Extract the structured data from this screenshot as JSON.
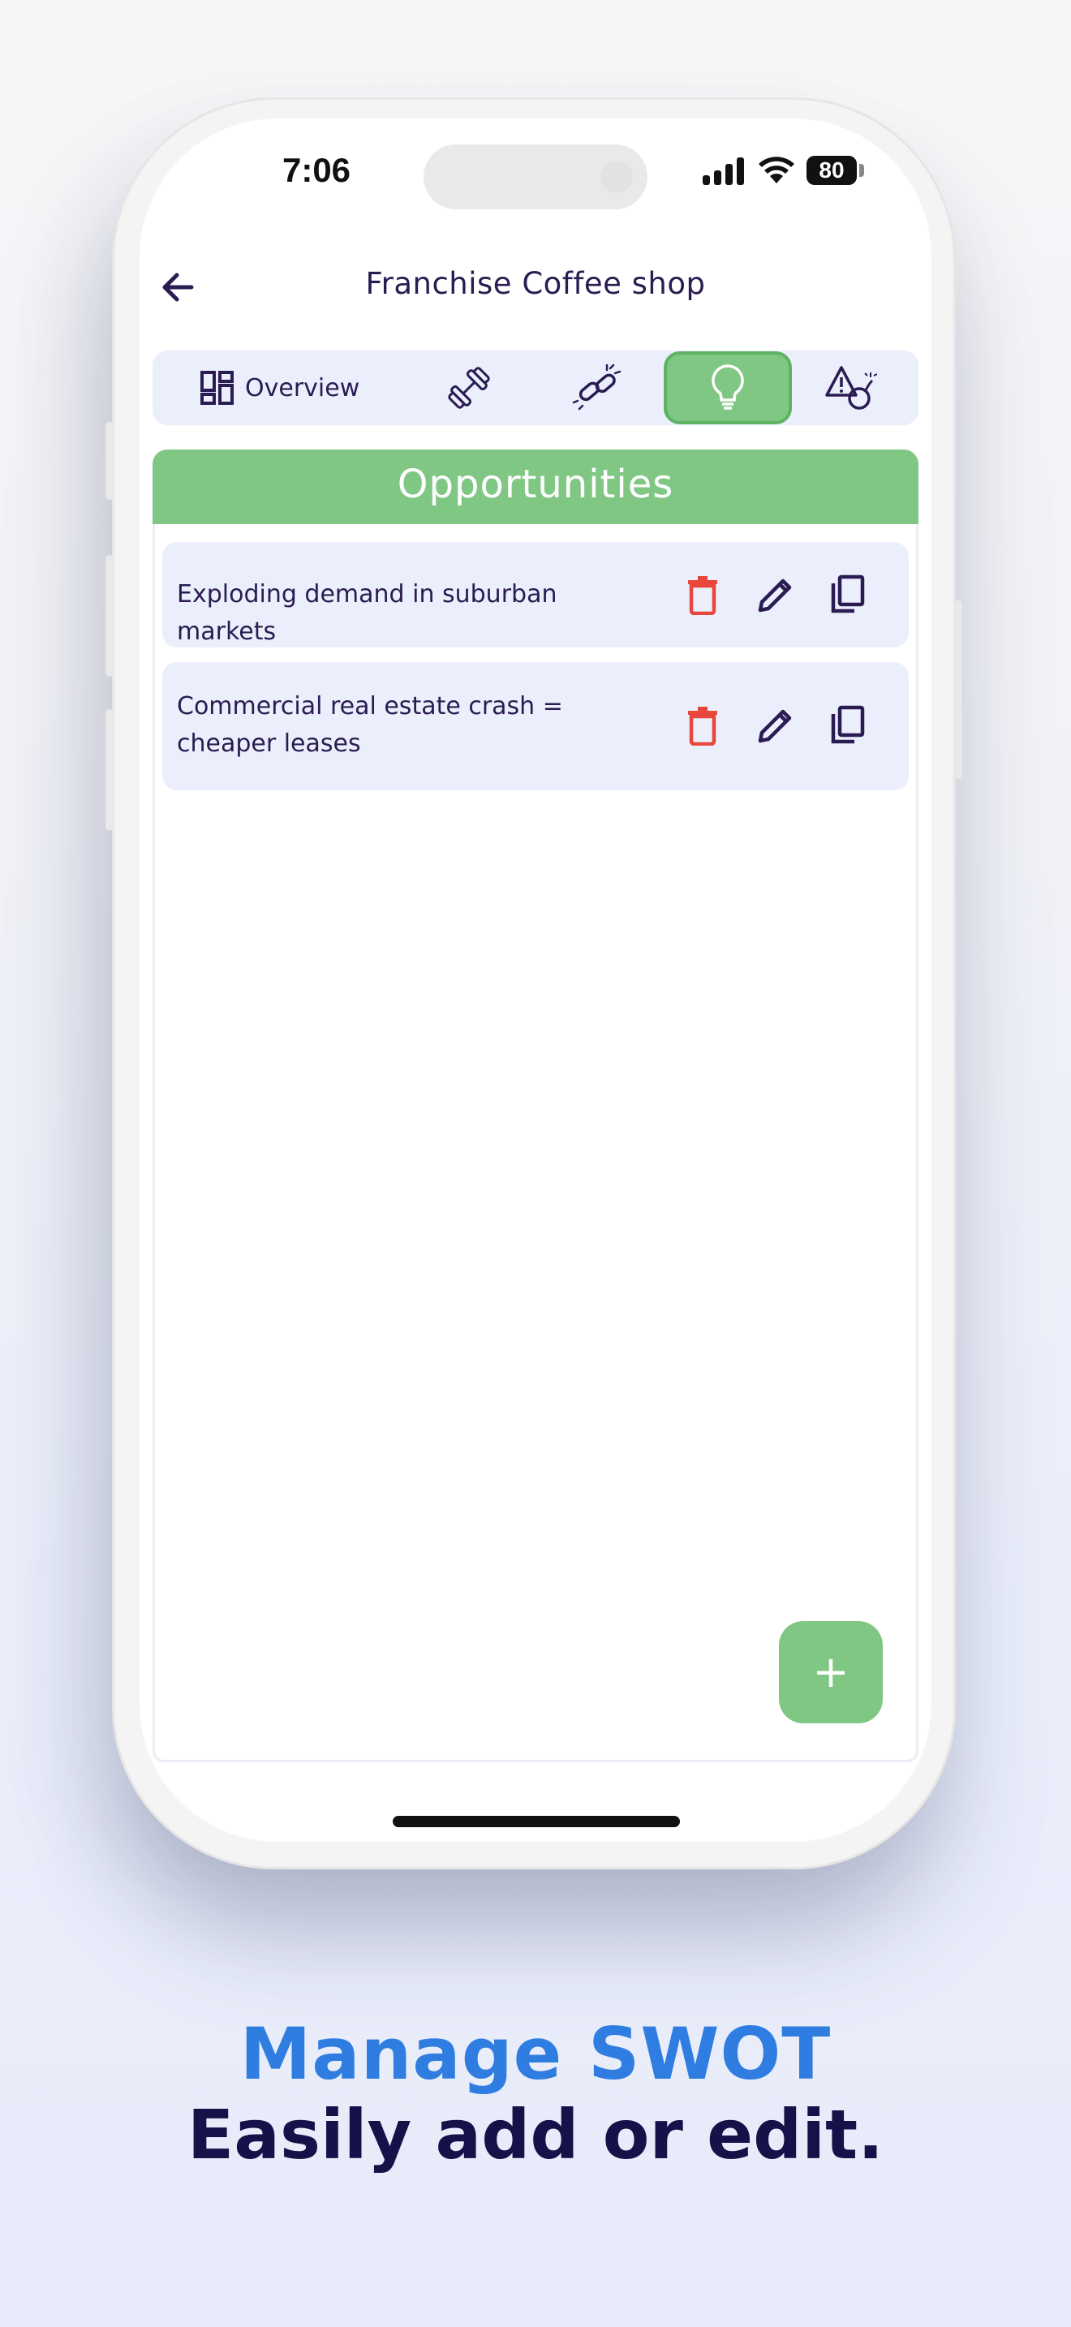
{
  "status_bar": {
    "time": "7:06",
    "battery": "80"
  },
  "header": {
    "title": "Franchise Coffee shop"
  },
  "tabs": [
    {
      "label": "Overview",
      "icon": "dashboard-icon"
    },
    {
      "label": "",
      "icon": "dumbbell-icon"
    },
    {
      "label": "",
      "icon": "broken-chain-icon"
    },
    {
      "label": "",
      "icon": "lightbulb-icon",
      "active": true
    },
    {
      "label": "",
      "icon": "warning-bomb-icon"
    }
  ],
  "section": {
    "title": "Opportunities",
    "color": "#80c784"
  },
  "items": [
    {
      "text": "Exploding demand in suburban markets"
    },
    {
      "text": "Commercial real estate crash = cheaper leases"
    }
  ],
  "fab": {
    "label": "+"
  },
  "marketing": {
    "headline": "Manage SWOT",
    "subline": "Easily add or edit."
  },
  "colors": {
    "accent_green": "#7fc782",
    "delete_red": "#e8473c",
    "ink": "#2a1c52",
    "headline_blue": "#2f7de0"
  }
}
